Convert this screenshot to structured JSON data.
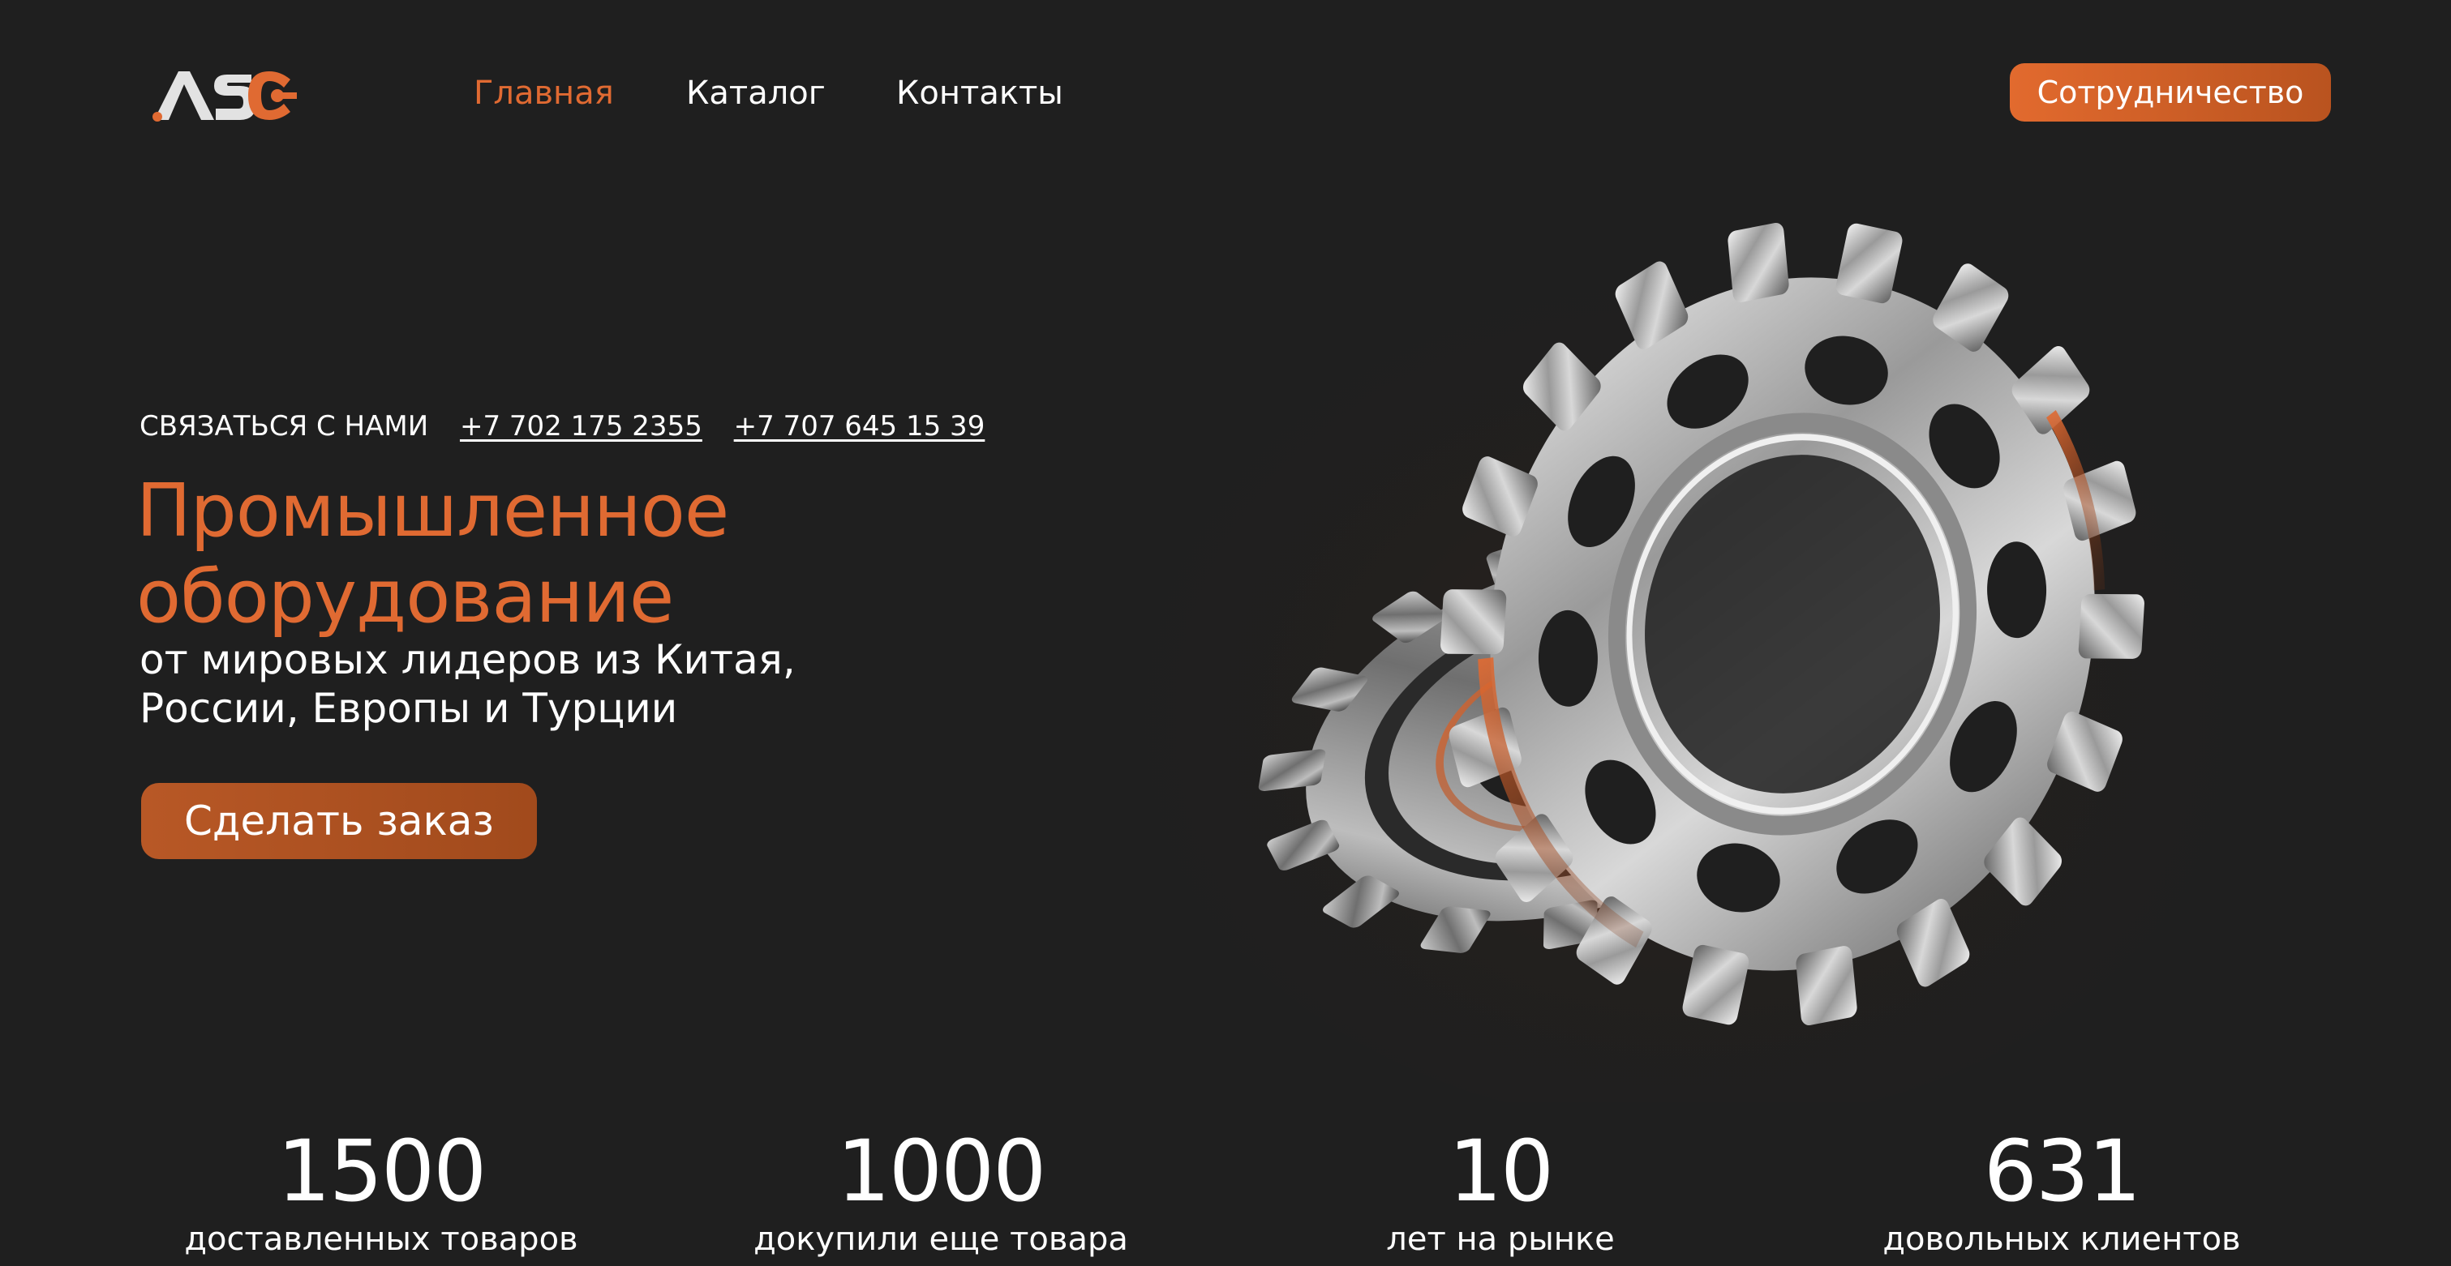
{
  "brand": {
    "logo_text": "ASC",
    "accent": "#e06a32",
    "background": "#1f1f1f"
  },
  "nav": {
    "items": [
      {
        "label": "Главная",
        "active": true
      },
      {
        "label": "Каталог",
        "active": false
      },
      {
        "label": "Контакты",
        "active": false
      }
    ],
    "cta_label": "Сотрудничество"
  },
  "hero": {
    "contact_label": "СВЯЗАТЬСЯ С НАМИ",
    "phones": [
      "+7 702 175 2355",
      "+7 707 645 15 39"
    ],
    "headline_line1": "Промышленное",
    "headline_line2": "оборудование",
    "subhead_line1": "от мировых лидеров из Китая,",
    "subhead_line2": "России, Европы и Турции",
    "order_label": "Сделать заказ"
  },
  "stats": [
    {
      "value": "1500",
      "label": "доставленных товаров"
    },
    {
      "value": "1000",
      "label": "докупили еще товара"
    },
    {
      "value": "10",
      "label": "лет на рынке"
    },
    {
      "value": "631",
      "label": "довольных клиентов"
    }
  ]
}
